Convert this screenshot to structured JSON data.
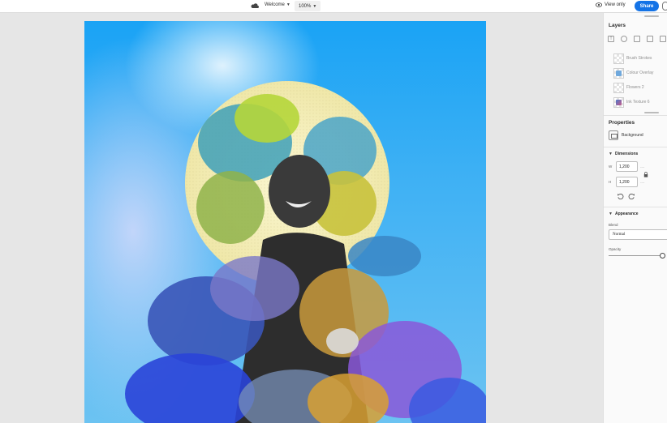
{
  "topbar": {
    "doc_title": "Welcome",
    "zoom": "100%",
    "view_only": "View only",
    "share": "Share"
  },
  "panel": {
    "layers_heading": "Layers",
    "layers": [
      {
        "name": "Brush Strokes"
      },
      {
        "name": "Colour Overlay"
      },
      {
        "name": "Flowers 2"
      },
      {
        "name": "Ink Texture 6"
      }
    ],
    "properties_heading": "Properties",
    "background_label": "Background",
    "dimensions_title": "Dimensions",
    "width_label": "W",
    "width_value": "1,200",
    "height_label": "H",
    "height_value": "1,200",
    "dash": "----",
    "appearance_title": "Appearance",
    "blend_label": "Blend",
    "blend_value": "Normal",
    "opacity_label": "Opacity",
    "opacity_level": 1.0
  },
  "colors": {
    "accent": "#1473e6",
    "canvas_bg": "#e6e6e6",
    "artwork_blue": "#1aa3f5",
    "sun_yellow": "#f6f0b8"
  }
}
